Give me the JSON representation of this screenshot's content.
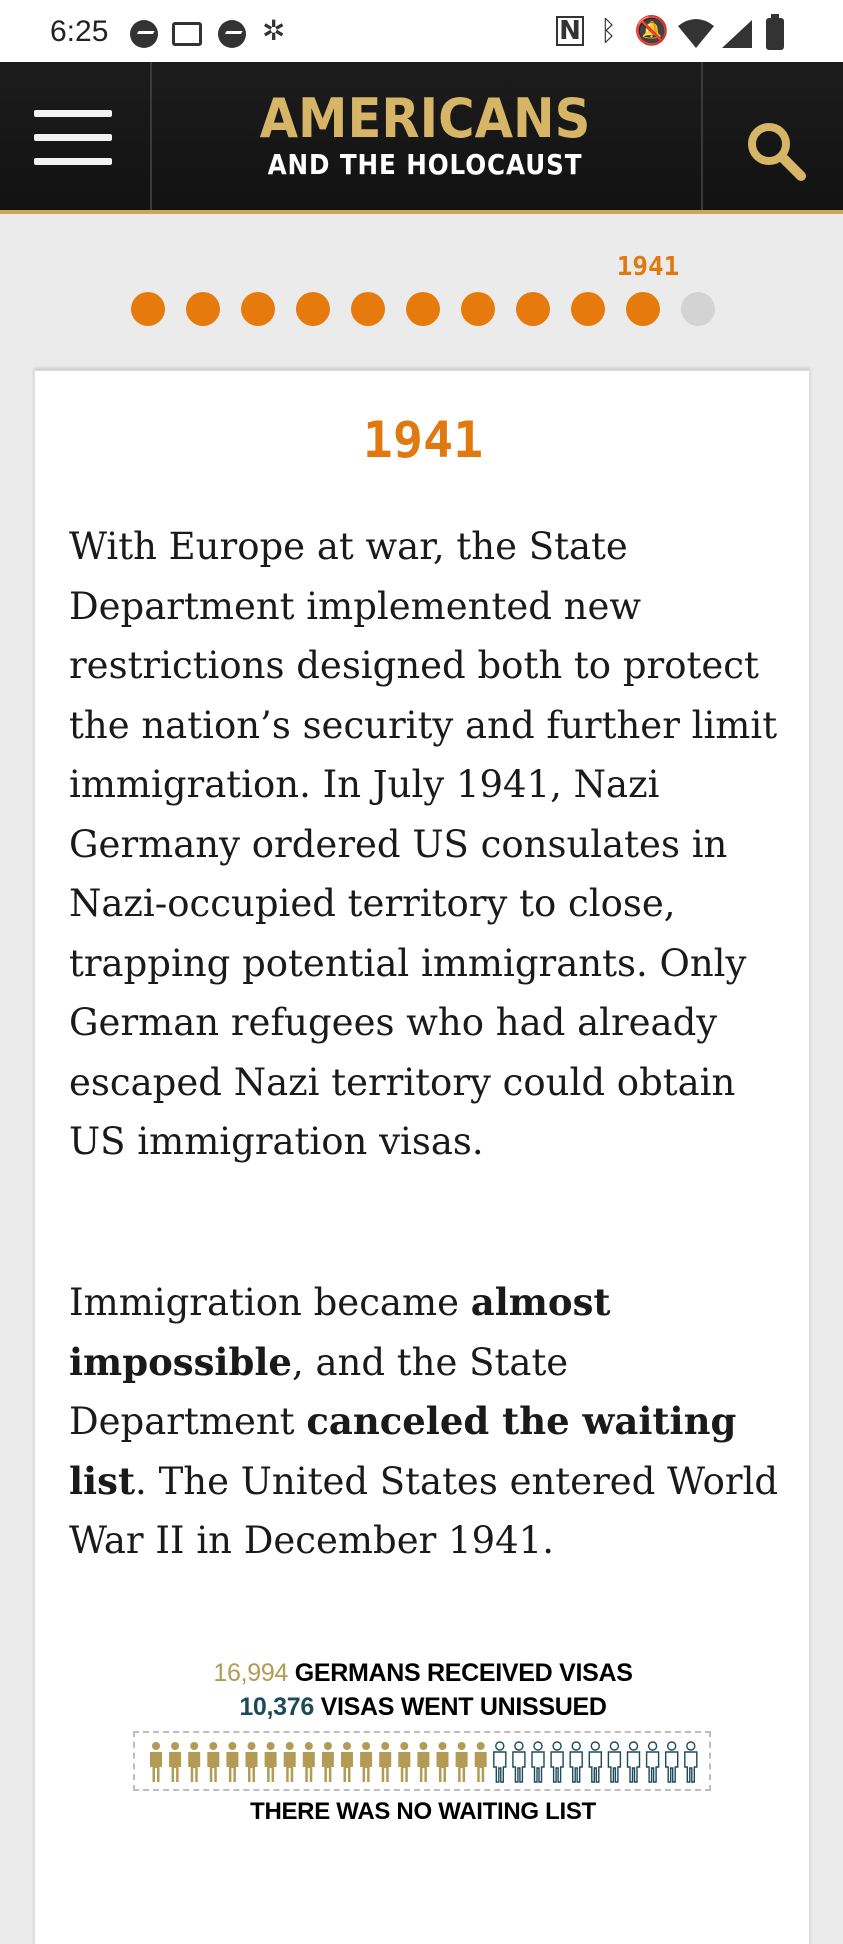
{
  "status_bar": {
    "time": "6:25",
    "left_icons": [
      "messenger-icon",
      "classroom-icon",
      "messenger-icon",
      "bug-icon"
    ],
    "right_icons": [
      "nfc-icon",
      "bluetooth-icon",
      "bell-off-icon",
      "wifi-icon",
      "signal-icon",
      "battery-icon"
    ]
  },
  "header": {
    "logo_top": "AMERICANS",
    "logo_bottom": "AND THE HOLOCAUST",
    "menu_icon": "hamburger-menu-icon",
    "search_icon": "search-icon"
  },
  "timeline": {
    "current_year_label": "1941",
    "total_dots": 11,
    "active_dots": 10,
    "active_color": "#e67a0c",
    "inactive_color": "#d3d3d3"
  },
  "card": {
    "year": "1941",
    "paragraph1": "With Europe at war, the State Department implemented new restrictions designed both to protect the nation’s security and further limit immigration. In July 1941, Nazi Germany ordered US consulates in Nazi-occupied territory to close, trapping potential immigrants. Only German refugees who had already escaped Nazi territory could obtain US immigration visas.",
    "p2_a": "Immigration became ",
    "p2_b": "almost impossible",
    "p2_c": ", and the State Department ",
    "p2_d": "canceled the waiting list",
    "p2_e": ". The United States entered World War II in December 1941."
  },
  "infographic": {
    "received_number": "16,994",
    "received_label": "GERMANS RECEIVED VISAS",
    "unissued_number": "10,376",
    "unissued_label": "VISAS WENT UNISSUED",
    "footer": "THERE WAS NO WAITING LIST",
    "filled_people": 18,
    "outline_people": 11,
    "filled_color": "#b39a55",
    "outline_color": "#1d4a5a"
  },
  "colors": {
    "accent_orange": "#e07a10",
    "header_gold": "#d6b567",
    "header_bg": "#161616"
  }
}
